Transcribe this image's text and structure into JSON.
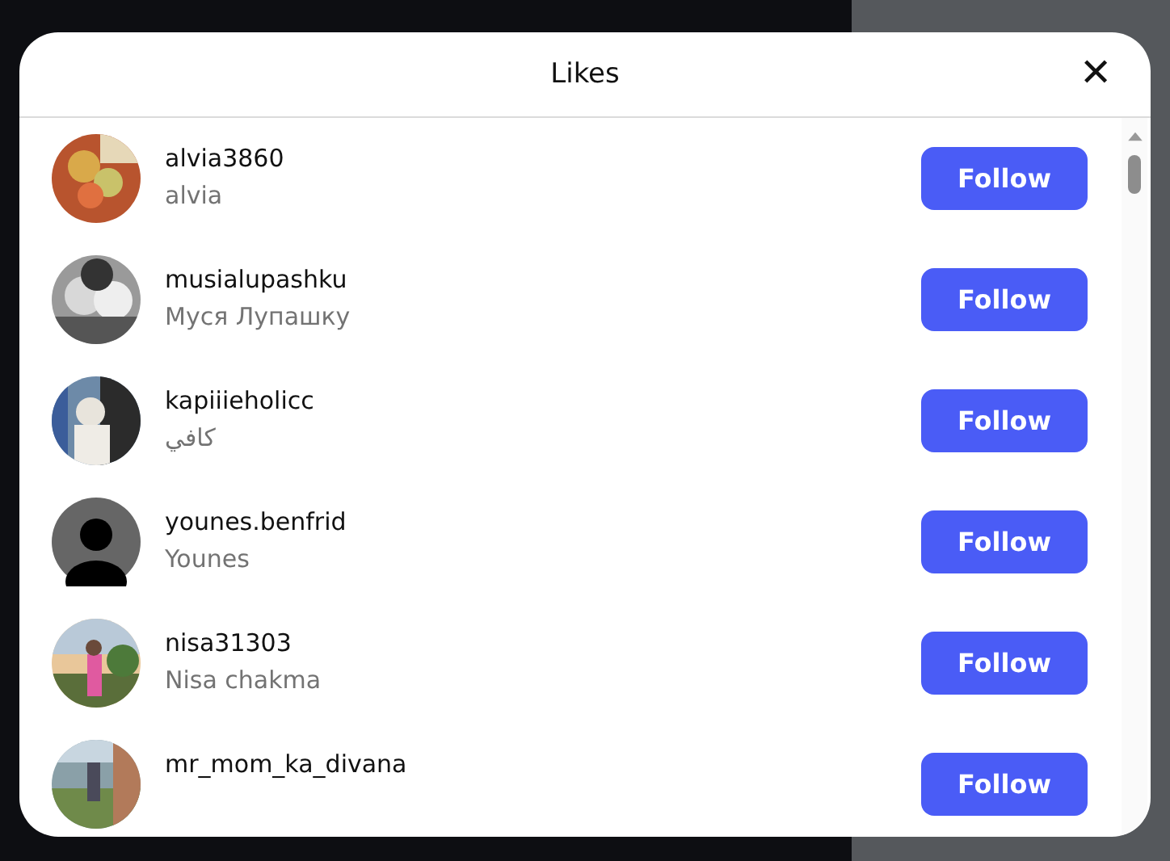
{
  "dialog": {
    "title": "Likes",
    "close": "✕"
  },
  "users": [
    {
      "username": "alvia3860",
      "name": "alvia",
      "button": "Follow"
    },
    {
      "username": "musialupashku",
      "name": "Муся Лупашку",
      "button": "Follow"
    },
    {
      "username": "kapiiieholicc",
      "name": "كافي",
      "button": "Follow"
    },
    {
      "username": "younes.benfrid",
      "name": "Younes",
      "avatar": {
        "kind": "default"
      },
      "button": "Follow"
    },
    {
      "username": "nisa31303",
      "name": "Nisa chakma",
      "button": "Follow"
    },
    {
      "username": "mr_mom_ka_divana",
      "button": "Follow"
    }
  ]
}
